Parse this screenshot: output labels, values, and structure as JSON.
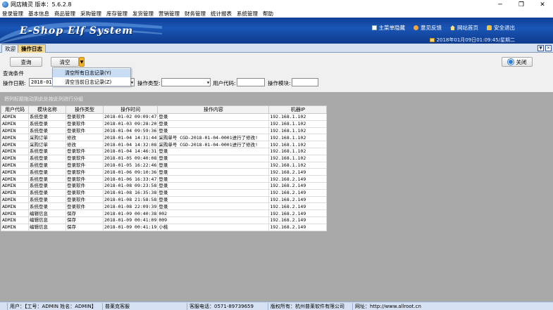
{
  "window": {
    "title": "网店精灵 版本：5.6.2.8",
    "minimize": "─",
    "restore": "❐",
    "close": "✕"
  },
  "menu": [
    "登录管理",
    "基本信息",
    "商品管理",
    "采购管理",
    "库存管理",
    "发货管理",
    "营销管理",
    "财务管理",
    "统计报表",
    "系统管理",
    "帮助"
  ],
  "banner": {
    "logo": "E-Shop Elf System",
    "links": [
      {
        "label": "主菜单隐藏",
        "icon": "menu-icon"
      },
      {
        "label": "意见反馈",
        "icon": "feedback-icon"
      },
      {
        "label": "网站首页",
        "icon": "home-icon"
      },
      {
        "label": "安全退出",
        "icon": "lock-icon"
      }
    ],
    "datetime": "2018年01月09日01:09:45/星期二"
  },
  "tabs": [
    "欢迎",
    "操作日志"
  ],
  "toolbar": {
    "query": "查询",
    "clear": "清空",
    "close": "关闭"
  },
  "dropdown": {
    "items": [
      "清空所有日志记录(Y)",
      "清空当前日志记录(Z)"
    ]
  },
  "conditions": {
    "title": "查询条件",
    "date_label": "操作日期:",
    "date_value": "2018-01-",
    "type_label": "操作类型:",
    "type_value": "",
    "user_label": "用户代码:",
    "user_value": "",
    "module_label": "操作模块:",
    "module_value": ""
  },
  "group_hint": "把列标题拖动到此处按此列进行分组",
  "grid": {
    "headers": [
      "用户代码",
      "模块名称",
      "操作类型",
      "操作时间",
      "操作内容",
      "机器IP"
    ],
    "rows": [
      [
        "ADMIN",
        "系统登录",
        "登录软件",
        "2018-01-02 09:09:47",
        "登录",
        "192.168.1.102"
      ],
      [
        "ADMIN",
        "系统登录",
        "登录软件",
        "2018-01-03 09:28:20",
        "登录",
        "192.168.1.102"
      ],
      [
        "ADMIN",
        "系统登录",
        "登录软件",
        "2018-01-04 09:59:36",
        "登录",
        "192.168.1.102"
      ],
      [
        "ADMIN",
        "采购订单",
        "修改",
        "2018-01-04 14:31:44",
        "采购单号 CGD-2018-01-04-0001进行了修改!",
        "192.168.1.102"
      ],
      [
        "ADMIN",
        "采购订单",
        "修改",
        "2018-01-04 14:32:08",
        "采购单号 CGD-2018-01-04-0001进行了修改!",
        "192.168.1.102"
      ],
      [
        "ADMIN",
        "系统登录",
        "登录软件",
        "2018-01-04 14:46:31",
        "登录",
        "192.168.1.102"
      ],
      [
        "ADMIN",
        "系统登录",
        "登录软件",
        "2018-01-05 09:40:08",
        "登录",
        "192.168.1.102"
      ],
      [
        "ADMIN",
        "系统登录",
        "登录软件",
        "2018-01-05 16:22:46",
        "登录",
        "192.168.1.102"
      ],
      [
        "ADMIN",
        "系统登录",
        "登录软件",
        "2018-01-06 09:10:36",
        "登录",
        "192.168.2.149"
      ],
      [
        "ADMIN",
        "系统登录",
        "登录软件",
        "2018-01-06 16:33:47",
        "登录",
        "192.168.2.149"
      ],
      [
        "ADMIN",
        "系统登录",
        "登录软件",
        "2018-01-08 09:23:58",
        "登录",
        "192.168.2.149"
      ],
      [
        "ADMIN",
        "系统登录",
        "登录软件",
        "2018-01-08 16:35:38",
        "登录",
        "192.168.2.149"
      ],
      [
        "ADMIN",
        "系统登录",
        "登录软件",
        "2018-01-08 21:58:58",
        "登录",
        "192.168.2.149"
      ],
      [
        "ADMIN",
        "系统登录",
        "登录软件",
        "2018-01-08 22:09:39",
        "登录",
        "192.168.2.149"
      ],
      [
        "ADMIN",
        "编辑信息",
        "保存",
        "2018-01-09 00:40:38",
        "002",
        "192.168.2.149"
      ],
      [
        "ADMIN",
        "编辑信息",
        "保存",
        "2018-01-09 00:41:09",
        "009",
        "192.168.2.149"
      ],
      [
        "ADMIN",
        "编辑信息",
        "保存",
        "2018-01-09 00:41:19",
        "小桃",
        "192.168.2.149"
      ]
    ]
  },
  "status": {
    "user": "用户：【工号：ADMIN 姓名：ADMIN】",
    "service": "普莱克客服",
    "phone": "客服电话：0571-89739659",
    "copyright": "版权所有：杭州普莱软件有限公司",
    "website": "网址：http://www.allroot.cn"
  },
  "colors": {
    "banner": "#1a56b6",
    "active_tab": "#f5d98c",
    "dropdown_selected": "#c8dcf4",
    "grid_bg": "#a9a9a9"
  }
}
